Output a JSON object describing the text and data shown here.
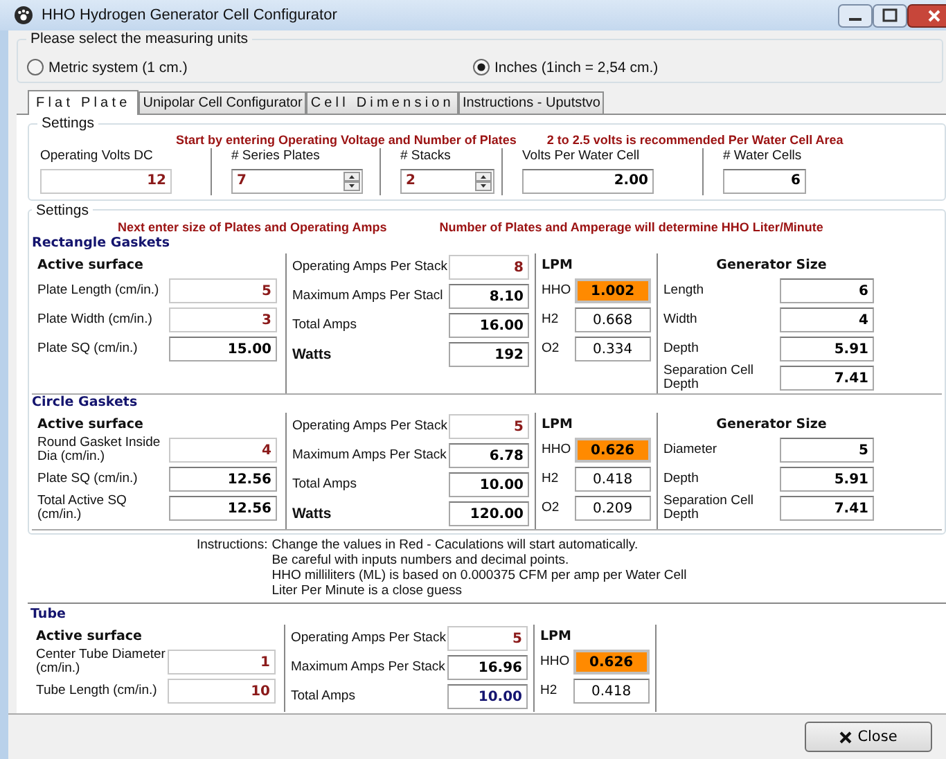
{
  "window": {
    "title": "HHO Hydrogen Generator Cell Configurator"
  },
  "units": {
    "legend": "Please select the measuring units",
    "options": [
      {
        "label": "Metric system (1 cm.)",
        "selected": false
      },
      {
        "label": "Inches (1inch = 2,54 cm.)",
        "selected": true
      }
    ]
  },
  "tabs": [
    {
      "label": "Flat Plate",
      "kind": "spaced",
      "selected": true
    },
    {
      "label": "Unipolar Cell Configurator",
      "kind": "plain",
      "selected": false
    },
    {
      "label": "Cell Dimension",
      "kind": "spaced",
      "selected": false
    },
    {
      "label": "Instructions - Uputstvo",
      "kind": "plain",
      "selected": false
    }
  ],
  "settings": {
    "legend": "Settings",
    "hints": [
      "Start by entering Operating Voltage and Number of Plates",
      "2 to 2.5 volts is recommended Per Water Cell Area"
    ],
    "fields": [
      {
        "label": "Operating Volts DC",
        "value": "12",
        "kind": "input"
      },
      {
        "label": "# Series Plates",
        "value": "7",
        "kind": "spinner"
      },
      {
        "label": "# Stacks",
        "value": "2",
        "kind": "spinner"
      },
      {
        "label": "Volts Per Water Cell",
        "value": "2.00",
        "kind": "output"
      },
      {
        "label": "# Water Cells",
        "value": "6",
        "kind": "output"
      }
    ]
  },
  "calculator": {
    "legend": "Settings",
    "hints": [
      "Next enter size of Plates and Operating Amps",
      "Number of Plates and Amperage will determine HHO Liter/Minute"
    ],
    "sections": [
      {
        "title": "Rectangle Gaskets",
        "surface": {
          "heading": "Active surface",
          "fields": [
            {
              "label": "Plate Length (cm/in.)",
              "value": "5",
              "kind": "input"
            },
            {
              "label": "Plate Width (cm/in.)",
              "value": "3",
              "kind": "input"
            },
            {
              "label": "Plate SQ (cm/in.)",
              "value": "15.00",
              "kind": "output"
            }
          ]
        },
        "amps": {
          "fields": [
            {
              "label": "Operating Amps Per Stack",
              "value": "8",
              "kind": "input"
            },
            {
              "label": "Maximum Amps Per Stacl",
              "value": "8.10",
              "kind": "output"
            },
            {
              "label": "Total Amps",
              "value": "16.00",
              "kind": "output"
            },
            {
              "label": "Watts",
              "value": "192",
              "kind": "output",
              "emphasis": true
            }
          ]
        },
        "lpm": {
          "heading": "LPM",
          "fields": [
            {
              "label": "HHO",
              "value": "1.002",
              "kind": "hho"
            },
            {
              "label": "H2",
              "value": "0.668",
              "kind": "plain"
            },
            {
              "label": "O2",
              "value": "0.334",
              "kind": "plain"
            }
          ]
        },
        "generator": {
          "heading": "Generator Size",
          "fields": [
            {
              "label": "Length",
              "value": "6",
              "kind": "output"
            },
            {
              "label": "Width",
              "value": "4",
              "kind": "output"
            },
            {
              "label": "Depth",
              "value": "5.91",
              "kind": "output"
            },
            {
              "label": "Separation Cell Depth",
              "value": "7.41",
              "kind": "output"
            }
          ]
        }
      },
      {
        "title": "Circle Gaskets",
        "surface": {
          "heading": "Active surface",
          "fields": [
            {
              "label": "Round Gasket Inside Dia (cm/in.)",
              "value": "4",
              "kind": "input"
            },
            {
              "label": "Plate SQ (cm/in.)",
              "value": "12.56",
              "kind": "output"
            },
            {
              "label": "Total Active SQ (cm/in.)",
              "value": "12.56",
              "kind": "output"
            }
          ]
        },
        "amps": {
          "fields": [
            {
              "label": "Operating Amps Per Stack",
              "value": "5",
              "kind": "input"
            },
            {
              "label": "Maximum Amps Per Stack",
              "value": "6.78",
              "kind": "output"
            },
            {
              "label": "Total Amps",
              "value": "10.00",
              "kind": "output"
            },
            {
              "label": "Watts",
              "value": "120.00",
              "kind": "output",
              "emphasis": true
            }
          ]
        },
        "lpm": {
          "heading": "LPM",
          "fields": [
            {
              "label": "HHO",
              "value": "0.626",
              "kind": "hho"
            },
            {
              "label": "H2",
              "value": "0.418",
              "kind": "plain"
            },
            {
              "label": "O2",
              "value": "0.209",
              "kind": "plain"
            }
          ]
        },
        "generator": {
          "heading": "Generator Size",
          "fields": [
            {
              "label": "Diameter",
              "value": "5",
              "kind": "output"
            },
            {
              "label": "Depth",
              "value": "5.91",
              "kind": "output"
            },
            {
              "label": "Separation Cell Depth",
              "value": "7.41",
              "kind": "output"
            }
          ]
        }
      }
    ]
  },
  "instructions": {
    "label": "Instructions:",
    "lines": [
      "Change the values in Red  - Caculations will start automatically.",
      "Be careful with inputs numbers and decimal points.",
      "HHO milliliters (ML) is based on 0.000375 CFM per amp per Water Cell",
      "Liter Per Minute is a close guess"
    ]
  },
  "tube": {
    "title": "Tube",
    "surface": {
      "heading": "Active surface",
      "fields": [
        {
          "label": "Center Tube Diameter (cm/in.)",
          "value": "1",
          "kind": "input"
        },
        {
          "label": "Tube Length (cm/in.)",
          "value": "10",
          "kind": "input"
        }
      ]
    },
    "amps": {
      "fields": [
        {
          "label": "Operating Amps Per Stack",
          "value": "5",
          "kind": "input"
        },
        {
          "label": "Maximum Amps Per Stack",
          "value": "16.96",
          "kind": "output"
        },
        {
          "label": "Total Amps",
          "value": "10.00",
          "kind": "linked"
        }
      ]
    },
    "lpm": {
      "heading": "LPM",
      "fields": [
        {
          "label": "HHO",
          "value": "0.626",
          "kind": "hho"
        },
        {
          "label": "H2",
          "value": "0.418",
          "kind": "plain"
        }
      ]
    }
  },
  "close_button": {
    "label": "Close"
  }
}
